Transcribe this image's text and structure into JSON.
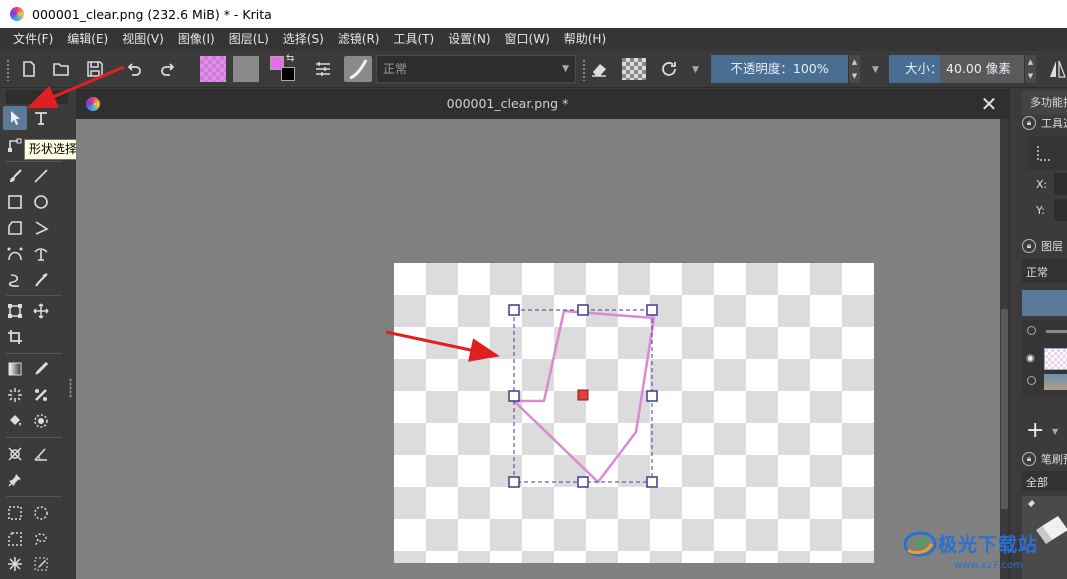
{
  "window": {
    "title": "000001_clear.png (232.6 MiB)  * - Krita"
  },
  "menubar": {
    "items": [
      "文件(F)",
      "编辑(E)",
      "视图(V)",
      "图像(I)",
      "图层(L)",
      "选择(S)",
      "滤镜(R)",
      "工具(T)",
      "设置(N)",
      "窗口(W)",
      "帮助(H)"
    ]
  },
  "toolbar": {
    "blend_mode": "正常",
    "opacity_label": "不透明度：100%",
    "size_label": "大小：",
    "size_value": "40.00 像素",
    "foreground_color": "#e86ee8",
    "background_color": "#000000"
  },
  "tooltip": {
    "text": "形状选择工具"
  },
  "document": {
    "tab_title": "000001_clear.png *"
  },
  "docker": {
    "tab_label": "多功能拾色器",
    "tool_options_label": "工具选项",
    "x_label": "X:",
    "y_label": "Y:",
    "layers_label": "图层",
    "layers_blend": "正常",
    "brushes_label": "笔刷预设",
    "brushes_filter": "全部"
  },
  "shape": {
    "stroke_color": "#d98ad4",
    "selection_color": "#3c3c8c"
  },
  "watermark": {
    "text": "极光下载站",
    "url": "www.xz7.com"
  },
  "annotation_color": "#e02020"
}
